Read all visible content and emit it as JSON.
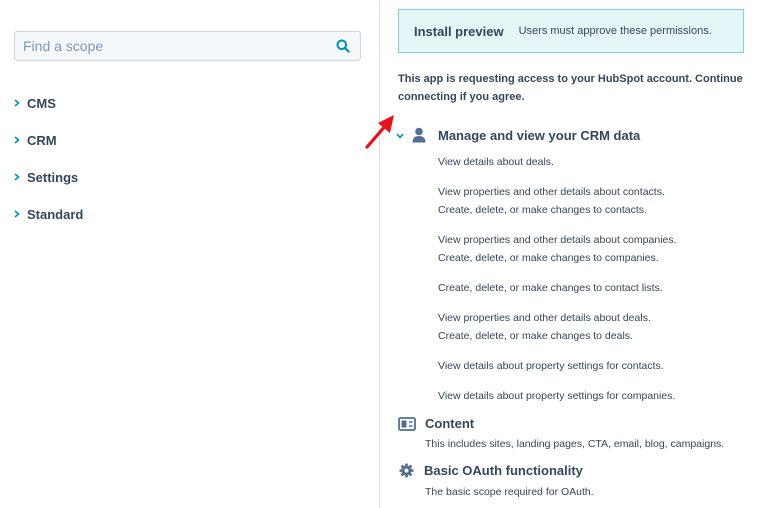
{
  "left_panel": {
    "search": {
      "placeholder": "Find a scope",
      "value": ""
    },
    "scopes": [
      {
        "label": "CMS"
      },
      {
        "label": "CRM"
      },
      {
        "label": "Settings"
      },
      {
        "label": "Standard"
      }
    ]
  },
  "right_panel": {
    "banner": {
      "title": "Install preview",
      "subtitle": "Users must approve these permissions."
    },
    "intro_line1": "This app is requesting access to your HubSpot account. Continue",
    "intro_line2": "connecting if you agree.",
    "crm_group": {
      "title": "Manage and view your CRM data",
      "icon": "user-icon",
      "permissions": [
        "View details about deals.",
        "View properties and other details about contacts.",
        "Create, delete, or make changes to contacts.",
        "View properties and other details about companies.",
        "Create, delete, or make changes to companies.",
        "Create, delete, or make changes to contact lists.",
        "View properties and other details about deals.",
        "Create, delete, or make changes to deals.",
        "View details about property settings for contacts.",
        "View details about property settings for companies."
      ]
    },
    "content_group": {
      "title": "Content",
      "icon": "content-layout-icon",
      "description": "This includes sites, landing pages, CTA, email, blog, campaigns."
    },
    "oauth_group": {
      "title": "Basic OAuth functionality",
      "icon": "gear-icon",
      "description": "The basic scope required for OAuth."
    }
  },
  "colors": {
    "text": "#33475b",
    "accent": "#0091ae",
    "banner_bg": "#e5f5f8",
    "banner_border": "#7fd1de",
    "arrow": "#e8101a"
  }
}
